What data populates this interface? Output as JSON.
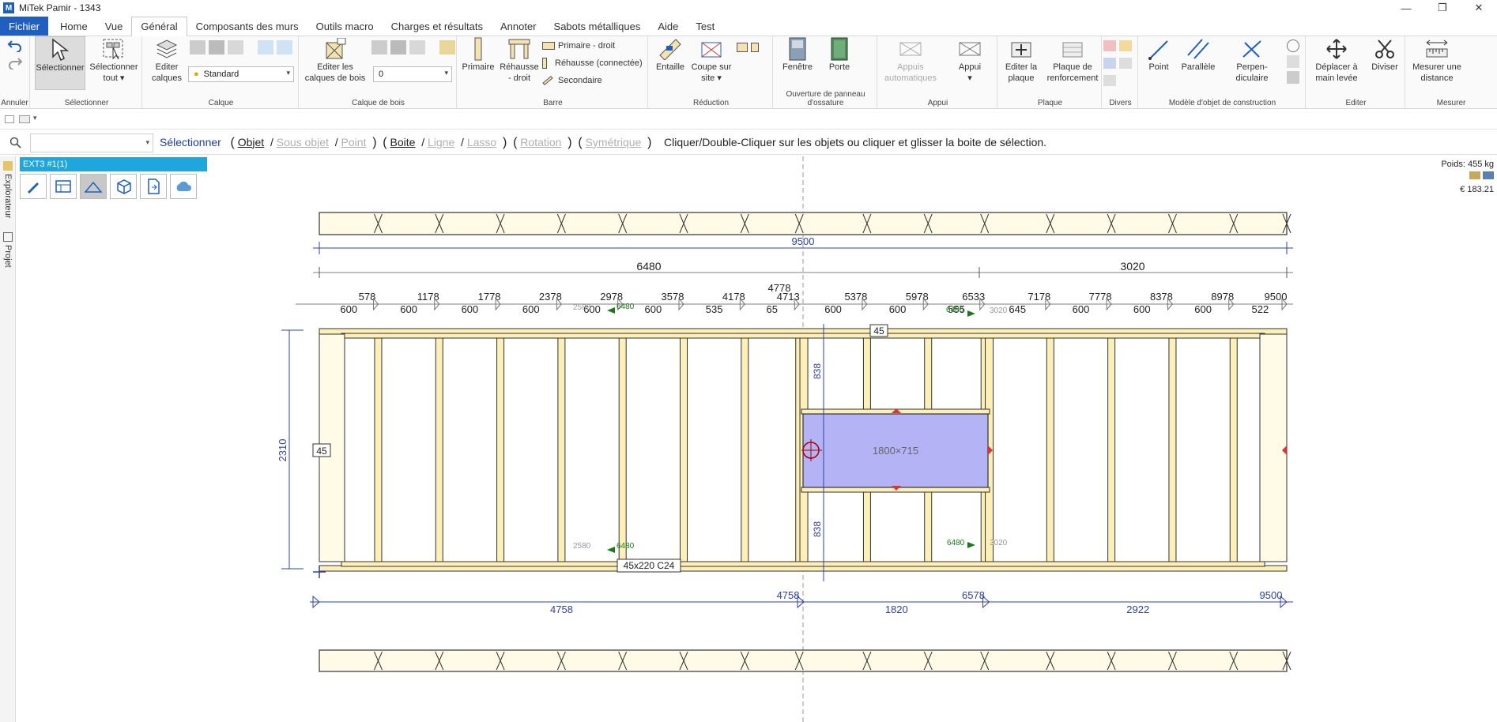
{
  "window": {
    "title": "MiTek Pamir - 1343",
    "minimize": "—",
    "restore": "❐",
    "close": "✕"
  },
  "tabs": [
    "Fichier",
    "Home",
    "Vue",
    "Général",
    "Composants des murs",
    "Outils macro",
    "Charges et résultats",
    "Annoter",
    "Sabots métalliques",
    "Aide",
    "Test"
  ],
  "ribbon": {
    "groups": {
      "annuler": "Annuler",
      "selectionner": "Sélectionner",
      "calque": "Calque",
      "calque_bois": "Calque de bois",
      "barre": "Barre",
      "reduction": "Réduction",
      "ouverture": "Ouverture de panneau d'ossature",
      "appui": "Appui",
      "plaque": "Plaque",
      "divers": "Divers",
      "modele": "Modèle d'objet de construction",
      "editer": "Editer",
      "mesurer": "Mesurer"
    },
    "buttons": {
      "selectionner": "Sélectionner",
      "selectionner_tout": "Sélectionner tout ▾",
      "editer_calques": "Editer calques",
      "calque_combo": "Standard",
      "editer_calques_bois": "Editer les calques de bois",
      "bois_combo": "0",
      "primaire": "Primaire",
      "rehausse_droit": "Réhausse - droit",
      "primaire_droit": "Primaire - droit",
      "rehausse_connectee": "Réhausse (connectée)",
      "secondaire": "Secondaire",
      "entaille": "Entaille",
      "coupe_sur_site": "Coupe sur site ▾",
      "fenetre": "Fenêtre",
      "porte": "Porte",
      "appuis_auto": "Appuis automatiques",
      "appui": "Appui",
      "editer_plaque": "Editer la plaque",
      "plaque_renfort": "Plaque de renforcement",
      "point": "Point",
      "parallele": "Parallèle",
      "perpendiculaire": "Perpen-diculaire",
      "deplacer": "Déplacer à main levée",
      "diviser": "Diviser",
      "mesurer": "Mesurer une distance"
    }
  },
  "command_bar": {
    "selectionner": "Sélectionner",
    "objet": "Objet",
    "sous_objet": "Sous objet",
    "point": "Point",
    "boite": "Boite",
    "ligne": "Ligne",
    "lasso": "Lasso",
    "rotation": "Rotation",
    "symetrique": "Symétrique",
    "hint": "Cliquer/Double-Cliquer sur les objets ou cliquer et glisser la boite de sélection."
  },
  "side_tabs": {
    "explorateur": "Explorateur",
    "projet": "Projet"
  },
  "panel": {
    "title": "EXT3 #1(1)",
    "weight": "Poids: 455 kg",
    "price": "€ 183.21"
  },
  "drawing": {
    "total_width": "9500",
    "span_left": "6480",
    "span_right": "3020",
    "height": "2310",
    "top_plate_label": "45",
    "left_stud_label": "45",
    "stud_tag": "45x220 C24",
    "window_label": "1800×715",
    "vertical_dim_top": "838",
    "vertical_dim_bottom": "838",
    "top_cumulative": [
      "578",
      "1178",
      "1778",
      "2378",
      "2978",
      "3578",
      "4178",
      "4713",
      "5378",
      "5978",
      "6533",
      "7178",
      "7778",
      "8378",
      "8978",
      "9500"
    ],
    "top_marker": "4778",
    "top_spacings": [
      "600",
      "600",
      "600",
      "600",
      "600",
      "600",
      "535",
      "65",
      "600",
      "600",
      "555",
      "645",
      "600",
      "600",
      "600",
      "522"
    ],
    "bottom_cumulative": [
      "4758",
      "6578",
      "9500"
    ],
    "bottom_spacings": [
      "4758",
      "1820",
      "2922"
    ],
    "joint_labels": {
      "top_left_gray": "2580",
      "top_left_green": "6480",
      "top_right_green": "6480",
      "top_right_gray": "3020",
      "bottom_left_gray": "2580",
      "bottom_left_green": "6480",
      "bottom_right_green": "6480",
      "bottom_right_gray": "3020"
    }
  }
}
